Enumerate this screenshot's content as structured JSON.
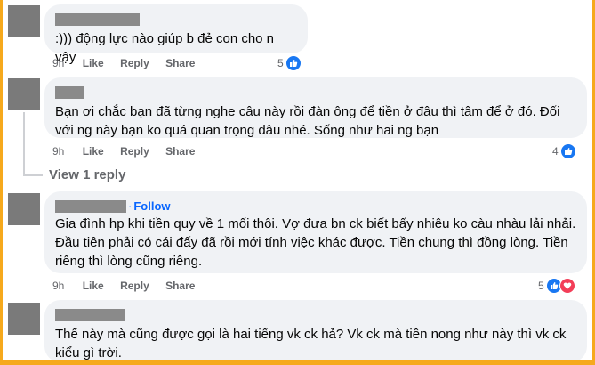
{
  "comments": [
    {
      "text": ":))) động lực nào giúp b đẻ con cho n vậy",
      "time": "9h",
      "like": "Like",
      "reply": "Reply",
      "share": "Share",
      "reaction_count": "5"
    },
    {
      "text": "Bạn ơi chắc bạn đã từng nghe câu này rồi đàn ông để tiền ở đâu thì tâm để ở đó. Đối với ng này bạn ko quá quan trọng đâu nhé. Sống như hai ng bạn",
      "time": "9h",
      "like": "Like",
      "reply": "Reply",
      "share": "Share",
      "reaction_count": "4",
      "view_replies": "View 1 reply"
    },
    {
      "follow": "Follow",
      "dot": "·",
      "text": "Gia đình hp khi tiền quy về 1 mối thôi. Vợ đưa bn ck biết bấy nhiêu ko càu nhàu lải nhải. Đầu tiên phải có cái đấy đã rồi mới tính việc khác được. Tiền chung thì đồng lòng. Tiền riêng thì lòng cũng riêng.",
      "time": "9h",
      "like": "Like",
      "reply": "Reply",
      "share": "Share",
      "reaction_count": "5"
    },
    {
      "text": "Thế này mà cũng được gọi là hai tiếng vk ck hả? Vk ck mà tiền nong như này thì vk ck kiểu gì trời."
    }
  ],
  "colors": {
    "frame": "#f6a91c",
    "bubble": "#f0f2f5",
    "link_blue": "#0866ff",
    "meta_gray": "#65676b",
    "like_blue": "#1877f2",
    "love_red": "#f33e58"
  },
  "icons": [
    "like-reaction-icon",
    "love-reaction-icon"
  ]
}
